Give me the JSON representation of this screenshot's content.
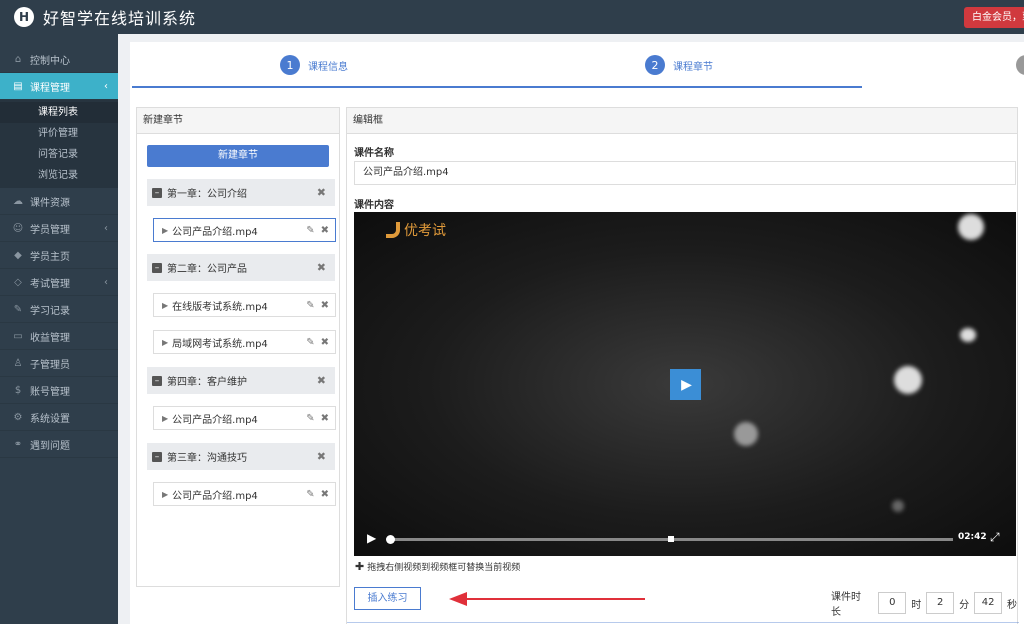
{
  "header": {
    "logo_letter": "H",
    "app_title": "好智学在线培训系统",
    "member_badge": "白金会员，到"
  },
  "sidebar": {
    "items": [
      {
        "icon": "home-icon",
        "glyph": "⌂",
        "label": "控制中心"
      },
      {
        "icon": "book-icon",
        "glyph": "▤",
        "label": "课程管理",
        "active": true
      },
      {
        "icon": "cloud-icon",
        "glyph": "☁",
        "label": "课件资源"
      },
      {
        "icon": "users-icon",
        "glyph": "👥",
        "label": "学员管理"
      },
      {
        "icon": "graduation-cap-icon",
        "glyph": "🎓",
        "label": "学员主页"
      },
      {
        "icon": "tag-icon",
        "glyph": "⌂",
        "label": "考试管理"
      },
      {
        "icon": "edit-icon",
        "glyph": "✎",
        "label": "学习记录"
      },
      {
        "icon": "card-icon",
        "glyph": "▭",
        "label": "收益管理"
      },
      {
        "icon": "user-icon",
        "glyph": "👤",
        "label": "子管理员"
      },
      {
        "icon": "dollar-icon",
        "glyph": "$",
        "label": "账号管理"
      },
      {
        "icon": "gear-icon",
        "glyph": "⚙",
        "label": "系统设置"
      },
      {
        "icon": "link-icon",
        "glyph": "⚭",
        "label": "遇到问题"
      }
    ],
    "sub_items": [
      "课程列表",
      "评价管理",
      "问答记录",
      "浏览记录"
    ]
  },
  "stepper": {
    "step1_num": "1",
    "step1_label": "课程信息",
    "step2_num": "2",
    "step2_label": "课程章节"
  },
  "chapters_panel": {
    "title": "新建章节",
    "new_button": "新建章节",
    "chapters": [
      {
        "title": "第一章：公司介绍",
        "lessons": [
          "公司产品介绍.mp4"
        ]
      },
      {
        "title": "第二章：公司产品",
        "lessons": [
          "在线版考试系统.mp4",
          "局域网考试系统.mp4"
        ]
      },
      {
        "title": "第四章：客户维护",
        "lessons": [
          "公司产品介绍.mp4"
        ]
      },
      {
        "title": "第三章：沟通技巧",
        "lessons": [
          "公司产品介绍.mp4"
        ]
      }
    ]
  },
  "editor": {
    "title": "编辑框",
    "name_label": "课件名称",
    "name_value": "公司产品介绍.mp4",
    "content_label": "课件内容",
    "video_watermark": "优考试",
    "video_duration": "02:42",
    "progress": 0.0,
    "hint": "拖拽右侧视频到视频框可替换当前视频",
    "insert_button": "插入练习",
    "duration_label": "课件时长",
    "hours": "0",
    "hours_unit": "时",
    "minutes": "2",
    "minutes_unit": "分",
    "seconds": "42",
    "seconds_unit": "秒"
  },
  "colors": {
    "sidebar_bg": "#2f3e4b",
    "active_nav": "#3db1c9",
    "primary": "#4a7bd0",
    "badge_red": "#d0393e",
    "watermark": "#e09a3a",
    "arrow_red": "#e0303a"
  }
}
